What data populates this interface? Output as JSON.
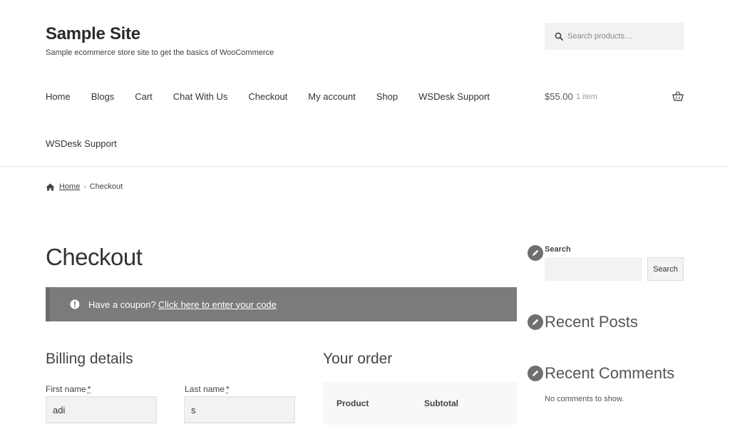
{
  "site": {
    "title": "Sample Site",
    "tagline": "Sample ecommerce store site to get the basics of WooCommerce"
  },
  "header_search": {
    "placeholder": "Search products…",
    "icon": "search-icon"
  },
  "nav": {
    "items": [
      "Home",
      "Blogs",
      "Cart",
      "Chat With Us",
      "Checkout",
      "My account",
      "Shop",
      "WSDesk Support"
    ],
    "second_row_item": "WSDesk Support"
  },
  "cart": {
    "amount": "$55.00",
    "count": "1 item",
    "icon": "basket-icon"
  },
  "breadcrumb": {
    "home": "Home",
    "current": "Checkout"
  },
  "page": {
    "title": "Checkout"
  },
  "coupon": {
    "text": "Have a coupon?",
    "link": "Click here to enter your code"
  },
  "billing": {
    "heading": "Billing details",
    "first_name_label": "First name",
    "first_name_value": "adi",
    "last_name_label": "Last name",
    "last_name_value": "s",
    "required_mark": "*"
  },
  "order": {
    "heading": "Your order",
    "col_product": "Product",
    "col_subtotal": "Subtotal"
  },
  "sidebar": {
    "search_label": "Search",
    "search_button": "Search",
    "recent_posts": "Recent Posts",
    "recent_comments": "Recent Comments",
    "no_comments": "No comments to show."
  },
  "colors": {
    "coupon_bg": "#7b7b7b",
    "input_bg": "#f2f2f2",
    "widget_icon_bg": "#6f6f6f"
  }
}
